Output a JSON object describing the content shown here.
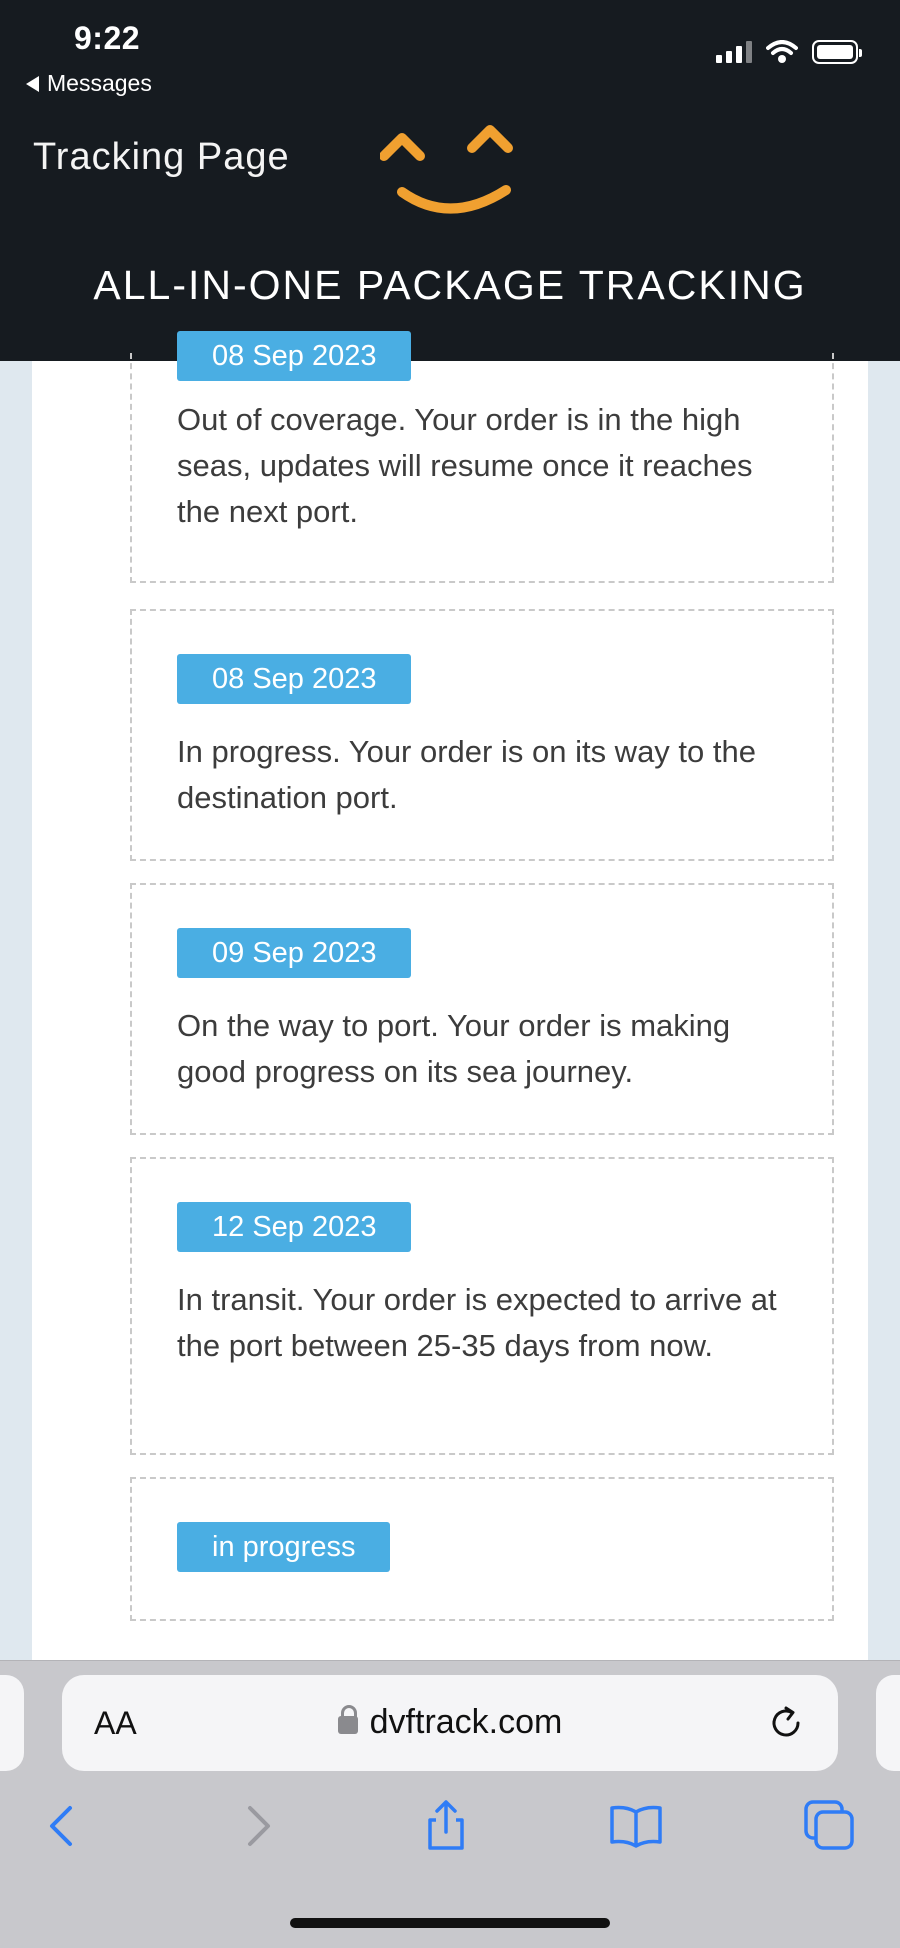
{
  "status_bar": {
    "time": "9:22",
    "back_label": "Messages"
  },
  "header": {
    "brand": "Tracking Page",
    "logo_icon": "smiley-face-logo",
    "tagline": "ALL-IN-ONE PACKAGE TRACKING",
    "background": "#161b20",
    "logo_color": "#f0a030"
  },
  "events": [
    {
      "date": "08 Sep 2023",
      "text": "Out of coverage. Your order is in the high seas, updates will resume once it reaches the next port."
    },
    {
      "date": "08 Sep 2023",
      "text": "In progress. Your order is on its way to the destination port."
    },
    {
      "date": "09 Sep 2023",
      "text": "On the way to port. Your order is making good progress on its sea journey."
    },
    {
      "date": "12 Sep 2023",
      "text": "In transit. Your order is expected to arrive at the port between 25-35 days from now."
    },
    {
      "date": "in progress",
      "text": ""
    }
  ],
  "browser": {
    "text_size_label": "AA",
    "url": "dvftrack.com",
    "accent": "#4aaee3"
  }
}
